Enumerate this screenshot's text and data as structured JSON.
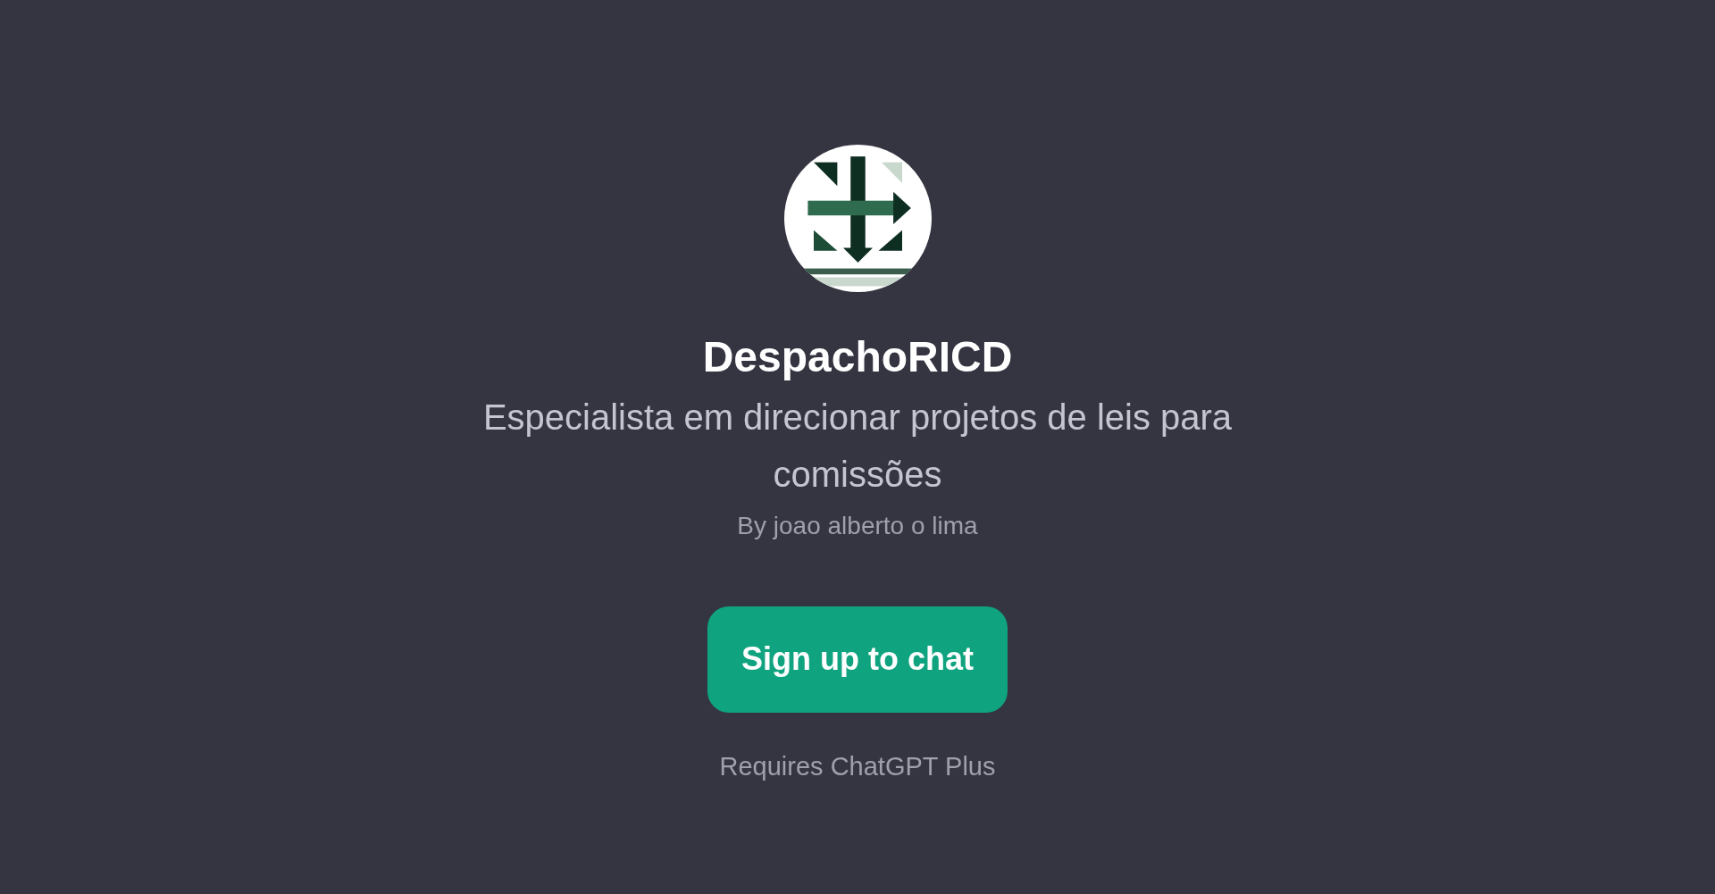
{
  "gpt": {
    "name": "DespachoRICD",
    "description": "Especialista em direcionar projetos de leis para comissões",
    "author": "By joao alberto o lima"
  },
  "signup_button": {
    "label": "Sign up to chat"
  },
  "requirement_note": "Requires ChatGPT Plus"
}
